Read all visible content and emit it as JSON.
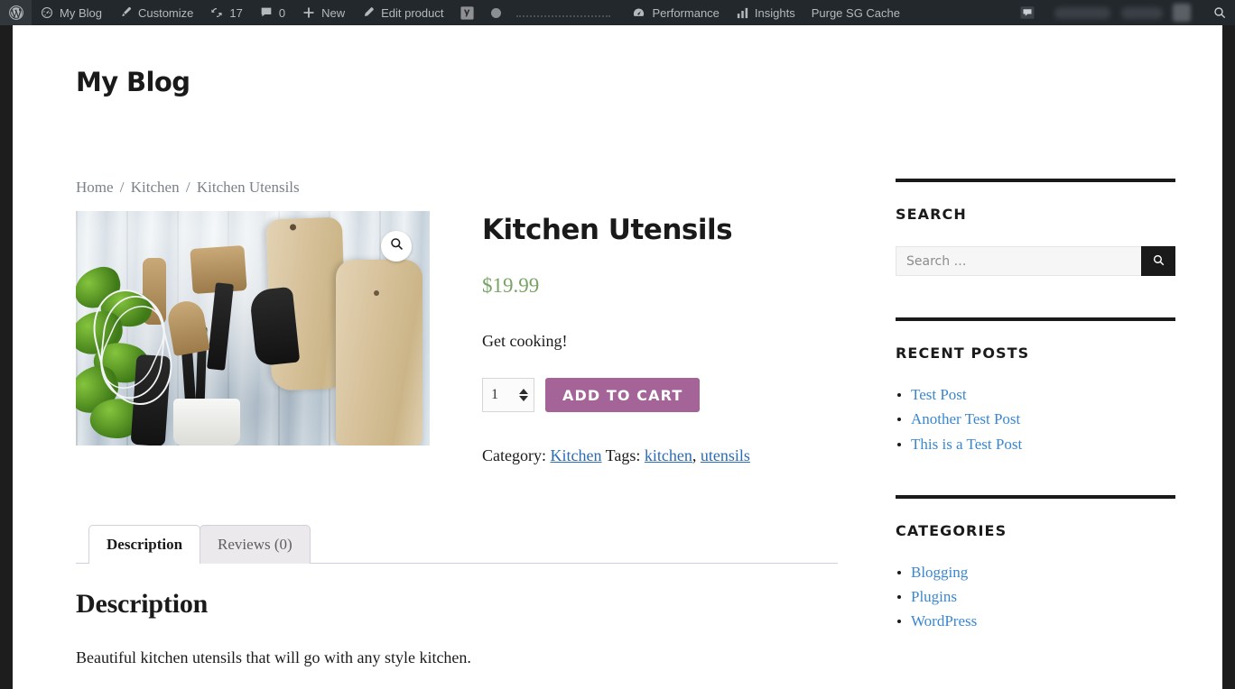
{
  "adminbar": {
    "wp_logo_label": "WordPress",
    "items": [
      {
        "name": "site-name",
        "label": "My Blog",
        "icon": "dashboard-gauge-icon"
      },
      {
        "name": "customize",
        "label": "Customize",
        "icon": "paintbrush-icon"
      },
      {
        "name": "updates",
        "label": "17",
        "icon": "update-arrows-icon"
      },
      {
        "name": "comments",
        "label": "0",
        "icon": "comment-bubble-icon"
      },
      {
        "name": "new-content",
        "label": "New",
        "icon": "plus-icon"
      },
      {
        "name": "edit-product",
        "label": "Edit product",
        "icon": "pencil-icon"
      }
    ],
    "yoast_icon": "yoast-seo-icon",
    "right_items": [
      {
        "name": "performance",
        "label": "Performance",
        "icon": "speed-gauge-icon"
      },
      {
        "name": "insights",
        "label": "Insights",
        "icon": "bar-chart-icon"
      },
      {
        "name": "purge-cache",
        "label": "Purge SG Cache",
        "icon": ""
      }
    ],
    "search_icon": "search-icon",
    "howdy_redacted": true
  },
  "site": {
    "title": "My Blog"
  },
  "breadcrumb": {
    "items": [
      "Home",
      "Kitchen",
      "Kitchen Utensils"
    ],
    "separator": "/"
  },
  "product": {
    "title": "Kitchen Utensils",
    "price": "$19.99",
    "price_color": "#77a464",
    "short_description": "Get cooking!",
    "quantity": "1",
    "add_to_cart_label": "ADD TO CART",
    "add_to_cart_color": "#a46497",
    "zoom_icon": "magnifier-icon",
    "image_alt": "Kitchen utensils in a white holder with wooden cutting boards and basil",
    "meta": {
      "category_label": "Category:",
      "category": "Kitchen",
      "tags_label": "Tags:",
      "tags": [
        "kitchen",
        "utensils"
      ],
      "tag_separator": ", "
    }
  },
  "tabs": {
    "items": [
      {
        "label": "Description",
        "active": true
      },
      {
        "label": "Reviews (0)",
        "active": false
      }
    ],
    "panel": {
      "heading": "Description",
      "body": "Beautiful kitchen utensils that will go with any style kitchen."
    }
  },
  "sidebar": {
    "widgets": [
      {
        "name": "search-widget",
        "title": "SEARCH",
        "type": "search",
        "placeholder": "Search …",
        "value": "",
        "button_icon": "search-icon"
      },
      {
        "name": "recent-posts-widget",
        "title": "RECENT POSTS",
        "type": "list",
        "links": [
          "Test Post",
          "Another Test Post",
          "This is a Test Post"
        ]
      },
      {
        "name": "categories-widget",
        "title": "CATEGORIES",
        "type": "list",
        "links": [
          "Blogging",
          "Plugins",
          "WordPress"
        ]
      }
    ]
  },
  "colors": {
    "adminbar_bg": "#23282d",
    "page_bg": "#1d1d1d",
    "link": "#3a87d0",
    "meta_link": "#2b6bb3",
    "accent": "#a46497",
    "price": "#77a464"
  }
}
